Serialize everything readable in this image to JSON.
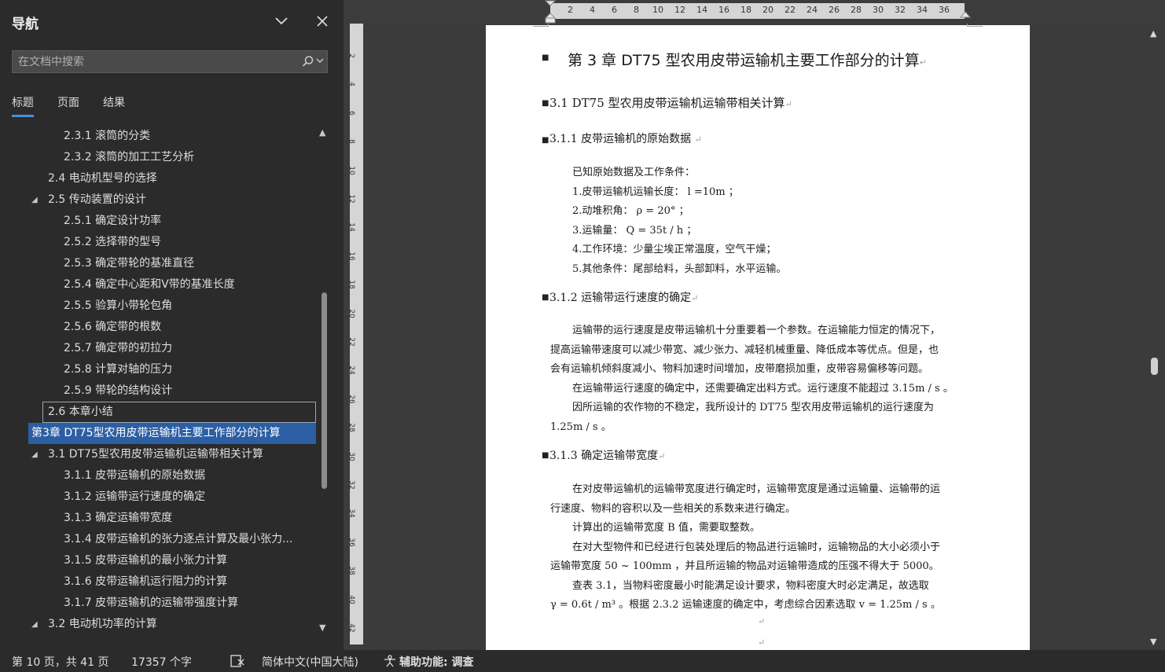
{
  "nav": {
    "title": "导航",
    "search_placeholder": "在文档中搜索",
    "tabs": [
      {
        "label": "标题"
      },
      {
        "label": "页面"
      },
      {
        "label": "结果"
      }
    ],
    "items": [
      {
        "label": "2.3.1 滚筒的分类",
        "level": 3
      },
      {
        "label": "2.3.2 滚筒的加工工艺分析",
        "level": 3
      },
      {
        "label": "2.4 电动机型号的选择",
        "level": 2
      },
      {
        "label": "2.5 传动装置的设计",
        "level": 2,
        "expanded": true
      },
      {
        "label": "2.5.1 确定设计功率",
        "level": 3
      },
      {
        "label": "2.5.2 选择带的型号",
        "level": 3
      },
      {
        "label": "2.5.3 确定带轮的基准直径",
        "level": 3
      },
      {
        "label": "2.5.4 确定中心距和V带的基准长度",
        "level": 3
      },
      {
        "label": "2.5.5 验算小带轮包角",
        "level": 3
      },
      {
        "label": "2.5.6 确定带的根数",
        "level": 3
      },
      {
        "label": "2.5.7 确定带的初拉力",
        "level": 3
      },
      {
        "label": "2.5.8 计算对轴的压力",
        "level": 3
      },
      {
        "label": "2.5.9 带轮的结构设计",
        "level": 3
      },
      {
        "label": "2.6 本章小结",
        "level": 2,
        "outlined": true
      },
      {
        "label": "第3章 DT75型农用皮带运输机主要工作部分的计算",
        "level": 1,
        "expanded": true,
        "current": true
      },
      {
        "label": "3.1 DT75型农用皮带运输机运输带相关计算",
        "level": 2,
        "expanded": true
      },
      {
        "label": "3.1.1 皮带运输机的原始数据",
        "level": 3
      },
      {
        "label": "3.1.2 运输带运行速度的确定",
        "level": 3
      },
      {
        "label": "3.1.3 确定运输带宽度",
        "level": 3
      },
      {
        "label": "3.1.4 皮带运输机的张力逐点计算及最小张力...",
        "level": 3
      },
      {
        "label": "3.1.5 皮带运输机的最小张力计算",
        "level": 3
      },
      {
        "label": "3.1.6 皮带运输机运行阻力的计算",
        "level": 3
      },
      {
        "label": "3.1.7 皮带运输机的运输带强度计算",
        "level": 3
      },
      {
        "label": "3.2 电动机功率的计算",
        "level": 2,
        "expanded": true
      }
    ]
  },
  "ruler": {
    "corner_label": "L",
    "h_ticks": [
      "2",
      "4",
      "6",
      "8",
      "10",
      "12",
      "14",
      "16",
      "18",
      "20",
      "22",
      "24",
      "26",
      "28",
      "30",
      "32",
      "34",
      "36"
    ],
    "v_ticks": [
      "2",
      "4",
      "6",
      "8",
      "10",
      "12",
      "14",
      "16",
      "18",
      "20",
      "22",
      "24",
      "26",
      "28",
      "30",
      "32",
      "34",
      "36",
      "38",
      "40",
      "42"
    ]
  },
  "document": {
    "chapter_title": "第 3 章  DT75 型农用皮带运输机主要工作部分的计算",
    "s31_title": "3.1 DT75 型农用皮带运输机运输带相关计算",
    "s311_title": "3.1.1  皮带运输机的原始数据 ",
    "s311_lines": [
      "已知原始数据及工作条件：",
      "1.皮带运输机运输长度： l =10m  ；",
      "2.动堆积角：   ρ = 20° ；",
      "3.运输量：   Q = 35t / h   ；",
      "4.工作环境：少量尘埃正常温度，空气干燥；",
      "5.其他条件：尾部给料，头部卸料，水平运输。"
    ],
    "s312_title": "3.1.2  运输带运行速度的确定",
    "s312_lines": [
      "运输带的运行速度是皮带运输机十分重要着一个参数。在运输能力恒定的情况下，",
      "提高运输带速度可以减少带宽、减少张力、减轻机械重量、降低成本等优点。但是，也",
      "会有运输机倾斜度减小、物料加速时间增加，皮带磨损加重，皮带容易偏移等问题。",
      "在运输带运行速度的确定中，还需要确定出料方式。运行速度不能超过 3.15m / s 。",
      "因所运输的农作物的不稳定，我所设计的 DT75 型农用皮带运输机的运行速度为",
      "1.25m / s 。"
    ],
    "s313_title": "3.1.3  确定运输带宽度",
    "s313_lines": [
      "在对皮带运输机的运输带宽度进行确定时，运输带宽度是通过运输量、运输带的运",
      "行速度、物料的容积以及一些相关的系数来进行确定。",
      "计算出的运输带宽度 B 值，需要取整数。",
      "在对大型物件和已经进行包装处理后的物品进行运输时，运输物品的大小必须小于",
      "运输带宽度 50 ~ 100mm ，并且所运输的物品对运输带造成的压强不得大于 5000。",
      "查表  3.1，当物料密度最小时能满足设计要求，物料密度大时必定满足，故选取",
      "γ = 0.6t / m³ 。根据 2.3.2 运输速度的确定中，考虑综合因素选取 v = 1.25m / s 。"
    ],
    "para_mark": "↵"
  },
  "status": {
    "page_info": "第 10 页，共 41 页",
    "word_count": "17357 个字",
    "language": "简体中文(中国大陆)",
    "accessibility": "辅助功能: 调查"
  }
}
